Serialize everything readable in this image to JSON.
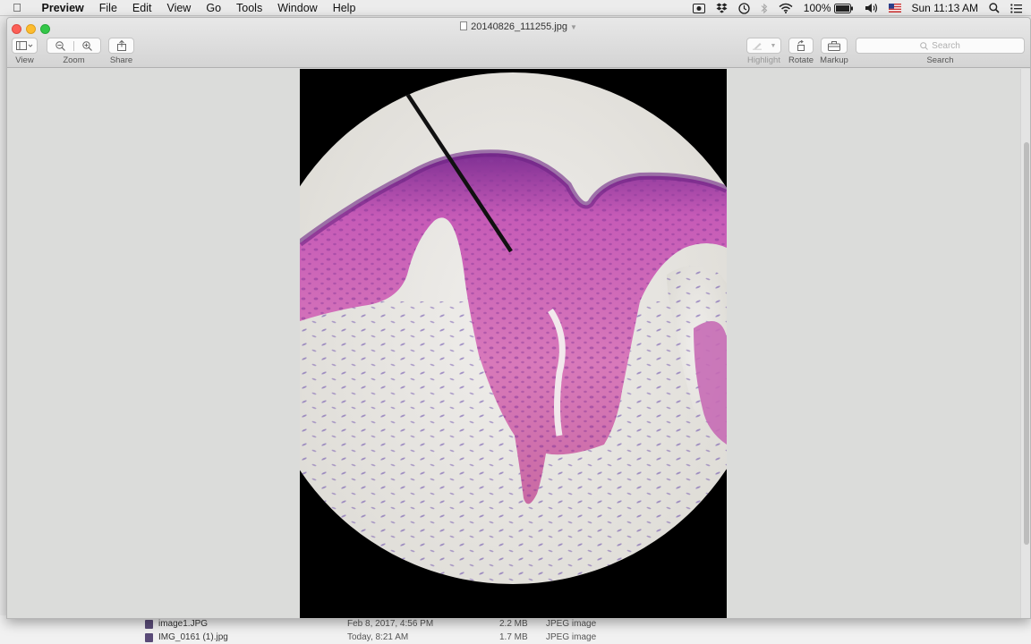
{
  "menubar": {
    "app_name": "Preview",
    "items": [
      "File",
      "Edit",
      "View",
      "Go",
      "Tools",
      "Window",
      "Help"
    ],
    "battery": "100%",
    "clock": "Sun 11:13 AM"
  },
  "window": {
    "title": "20140826_111255.jpg",
    "toolbar": {
      "view_label": "View",
      "zoom_label": "Zoom",
      "share_label": "Share",
      "highlight_label": "Highlight",
      "rotate_label": "Rotate",
      "markup_label": "Markup",
      "search_label": "Search",
      "search_placeholder": "Search"
    }
  },
  "finder": {
    "rows": [
      {
        "name": "image1.JPG",
        "date": "Feb 8, 2017, 4:56 PM",
        "size": "2.2 MB",
        "kind": "JPEG image"
      },
      {
        "name": "IMG_0161 (1).jpg",
        "date": "Today, 8:21 AM",
        "size": "1.7 MB",
        "kind": "JPEG image"
      }
    ]
  },
  "icons": {
    "apple": "apple-icon",
    "view": "sidebar-icon",
    "zoom_out": "zoom-out-icon",
    "zoom_in": "zoom-in-icon",
    "share": "share-icon",
    "highlight": "pen-icon",
    "rotate": "rotate-icon",
    "markup": "toolbox-icon",
    "search": "search-icon"
  },
  "colors": {
    "close": "#fc5f57",
    "minimize": "#fdbc2e",
    "zoom": "#33c748",
    "tissue": "#c65bb7",
    "background_tissue": "#e8e6e6"
  }
}
